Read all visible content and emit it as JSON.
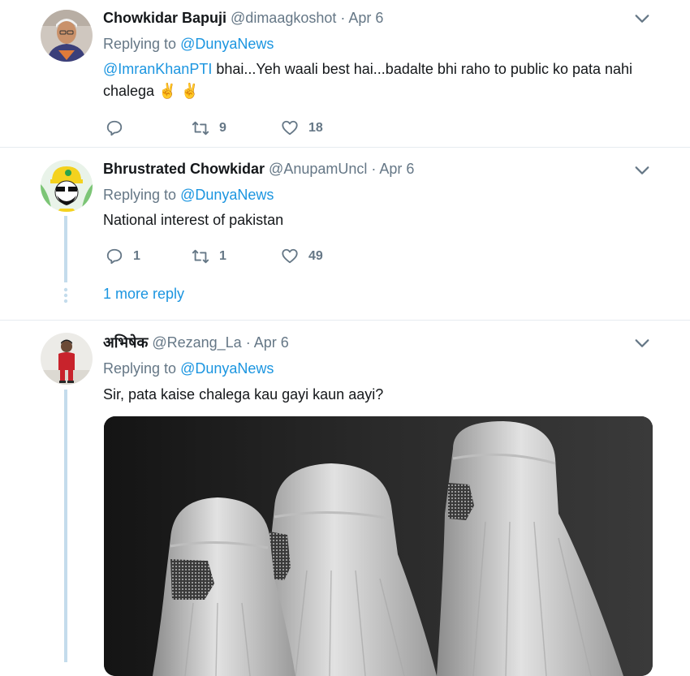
{
  "tweets": [
    {
      "name": "Chowkidar Bapuji",
      "handle": "@dimaagkoshot",
      "dot": "·",
      "date": "Apr 6",
      "replying_prefix": "Replying to",
      "replying_to": "@DunyaNews",
      "mention": "@ImranKhanPTI",
      "text": " bhai...Yeh waali best hai...badalte bhi raho to public ko pata nahi chalega ",
      "emoji": "✌️ ✌️",
      "replies": "",
      "retweets": "9",
      "likes": "18"
    },
    {
      "name": "Bhrustrated Chowkidar",
      "handle": "@AnupamUncl",
      "dot": "·",
      "date": "Apr 6",
      "replying_prefix": "Replying to",
      "replying_to": "@DunyaNews",
      "text": "National interest of pakistan",
      "replies": "1",
      "retweets": "1",
      "likes": "49",
      "more_reply": "1 more reply"
    },
    {
      "name": "अभिषेक",
      "handle": "@Rezang_La",
      "dot": "·",
      "date": "Apr 6",
      "replying_prefix": "Replying to",
      "replying_to": "@DunyaNews",
      "text": "Sir, pata kaise chalega kau gayi kaun aayi?"
    }
  ],
  "colors": {
    "link": "#1b95e0",
    "muted": "#657786",
    "thread": "#c4dcec",
    "divider": "#e6ecf0"
  },
  "icons": [
    "chevron-down-icon",
    "reply-icon",
    "retweet-icon",
    "like-icon"
  ]
}
